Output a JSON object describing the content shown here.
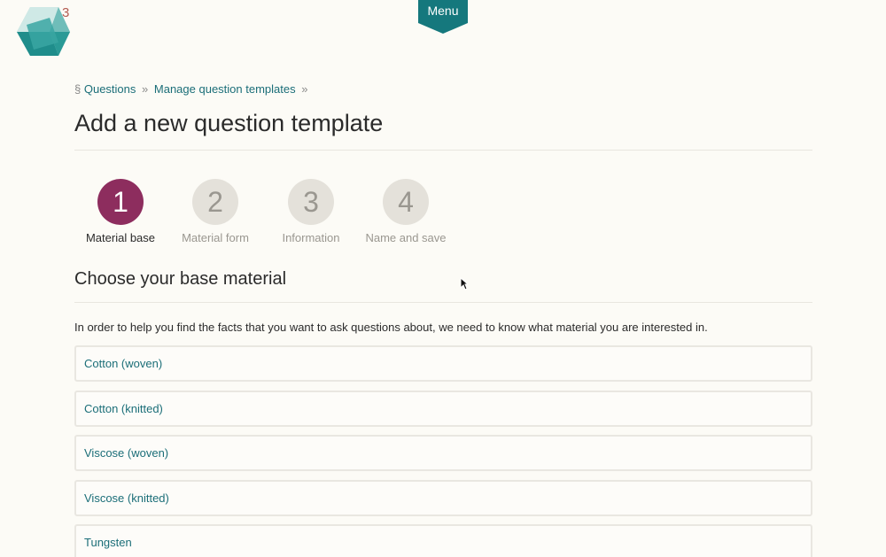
{
  "logo": {
    "badge": "3",
    "icon": "hexagon-logo-icon",
    "colors": {
      "teal": "#1a8f8f",
      "light_teal": "#7ec5c2",
      "badge": "#b35c52"
    }
  },
  "menu": {
    "label": "Menu",
    "color": "#15787d"
  },
  "breadcrumb": {
    "prefix": "§",
    "items": [
      "Questions",
      "Manage question templates"
    ],
    "separator": "»"
  },
  "page_title": "Add a new question template",
  "steps": [
    {
      "number": "1",
      "label": "Material base",
      "active": true
    },
    {
      "number": "2",
      "label": "Material form",
      "active": false
    },
    {
      "number": "3",
      "label": "Information",
      "active": false
    },
    {
      "number": "4",
      "label": "Name and save",
      "active": false
    }
  ],
  "section": {
    "title": "Choose your base material",
    "intro": "In order to help you find the facts that you want to ask questions about, we need to know what material you are interested in."
  },
  "materials": [
    "Cotton (woven)",
    "Cotton (knitted)",
    "Viscose (woven)",
    "Viscose (knitted)",
    "Tungsten"
  ],
  "colors": {
    "accent": "#8d2d5e",
    "link": "#1b6e78",
    "background": "#fcfbf6"
  }
}
